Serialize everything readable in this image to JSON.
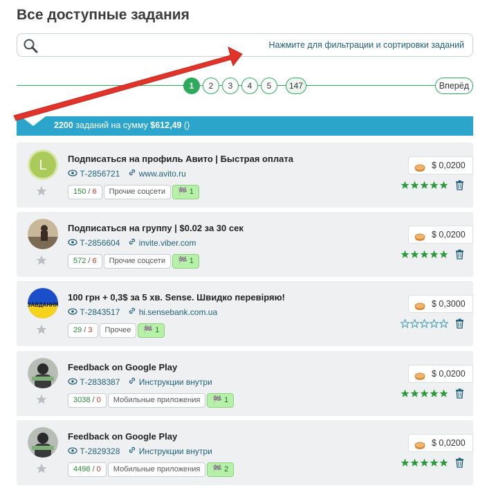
{
  "page_title": "Все доступные задания",
  "search": {
    "hint": "Нажмите для фильтрации и сортировки заданий"
  },
  "pagination": {
    "pages": [
      "1",
      "2",
      "3",
      "4",
      "5",
      "147"
    ],
    "active": "1",
    "next_label": "Вперёд"
  },
  "summary": {
    "count": "2200",
    "text_middle": " заданий на сумму ",
    "amount": "$612,49",
    "tail": " ()"
  },
  "tasks": [
    {
      "title": "Подписаться на профиль Авито | Быстрая оплата",
      "id": "Т-2856721",
      "link": "www.avito.ru",
      "done": "150",
      "rejected": "6",
      "category": "Прочие соцсети",
      "flags": "1",
      "price": "$ 0,0200",
      "rating": 5,
      "avatar": "L"
    },
    {
      "title": "Подписаться на группу | $0.02 за 30 сек",
      "id": "Т-2856604",
      "link": "invite.viber.com",
      "done": "572",
      "rejected": "6",
      "category": "Прочие соцсети",
      "flags": "1",
      "price": "$ 0,0200",
      "rating": 5,
      "avatar": ""
    },
    {
      "title": "100 грн + 0,3$ за 5 хв. Sense. Швидко перевіряю!",
      "id": "Т-2843517",
      "link": "hi.sensebank.com.ua",
      "done": "29",
      "rejected": "3",
      "category": "Прочее",
      "flags": "1",
      "price": "$ 0,3000",
      "rating": 0,
      "avatar": "ЗАВДАННЯ"
    },
    {
      "title": "Feedback on Google Play",
      "id": "Т-2838387",
      "link": "Инструкции внутри",
      "done": "3038",
      "rejected": "0",
      "category": "Мобильные приложения",
      "flags": "1",
      "price": "$ 0,0200",
      "rating": 5,
      "avatar": ""
    },
    {
      "title": "Feedback on Google Play",
      "id": "Т-2829328",
      "link": "Инструкции внутри",
      "done": "4498",
      "rejected": "0",
      "category": "Мобильные приложения",
      "flags": "2",
      "price": "$ 0,0200",
      "rating": 5,
      "avatar": ""
    }
  ],
  "colors": {
    "accent_green": "#2faa5c",
    "summary_blue": "#2ba5cc",
    "star_green": "#2a9a3a",
    "arrow_red": "#e0342a"
  }
}
